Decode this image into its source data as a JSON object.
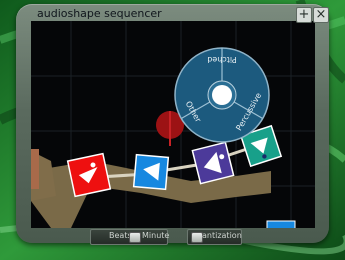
{
  "window": {
    "title": "audioshape sequencer",
    "add_label": "+",
    "close_label": "×"
  },
  "wheel": {
    "segments": [
      "Pitched",
      "Percussive",
      "Other"
    ]
  },
  "bottom": {
    "tempo_left": "Beats",
    "tempo_right": "Minute",
    "quant_label": "antization"
  },
  "colors": {
    "canvas": "#050608",
    "wheel": "#1c5a7e",
    "shape_red": "#ee1010",
    "shape_blue": "#1788e0",
    "shape_purple": "#4c3a9a",
    "shape_teal": "#18a08a"
  }
}
